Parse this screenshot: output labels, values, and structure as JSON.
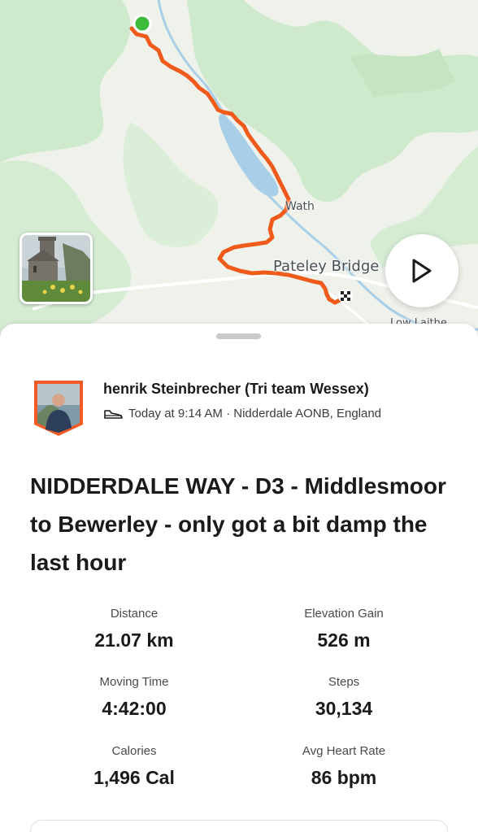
{
  "map": {
    "places": {
      "wath": "Wath",
      "pateley_bridge": "Pateley Bridge",
      "low_laithe": "Low Laithe"
    },
    "colors": {
      "route": "#f05a1a",
      "start": "#3dbb3d",
      "water": "#a9cfe8",
      "forest": "#cfe9cd",
      "land": "#eef2ea"
    },
    "play_icon": "play-icon",
    "photo_icon": "church-photo"
  },
  "athlete": {
    "name": "henrik Steinbrecher (Tri team Wessex)",
    "activity_icon": "shoe-icon",
    "meta": "Today at 9:14 AM · Nidderdale AONB, England"
  },
  "activity": {
    "title": "NIDDERDALE WAY - D3 - Middlesmoor to Bewerley - only got a bit damp the last hour"
  },
  "stats": [
    {
      "label": "Distance",
      "value": "21.07 km"
    },
    {
      "label": "Elevation Gain",
      "value": "526 m"
    },
    {
      "label": "Moving Time",
      "value": "4:42:00"
    },
    {
      "label": "Steps",
      "value": "30,134"
    },
    {
      "label": "Calories",
      "value": "1,496 Cal"
    },
    {
      "label": "Avg Heart Rate",
      "value": "86 bpm"
    }
  ]
}
